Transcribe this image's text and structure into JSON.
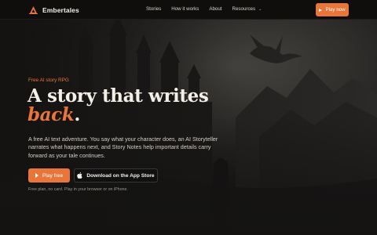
{
  "brand": {
    "name": "Embertales",
    "logo_icon": "flame-icon",
    "accent": "#e8753a"
  },
  "nav": {
    "links": [
      {
        "label": "Stories"
      },
      {
        "label": "How it works"
      },
      {
        "label": "About"
      },
      {
        "label": "Resources",
        "has_menu": true,
        "menu_icon": "chevron-down-icon"
      }
    ],
    "cta_label": "Play now"
  },
  "hero": {
    "eyebrow": "Free AI story RPG",
    "headline_main": "A story that writes",
    "headline_accent": "back",
    "headline_end": ".",
    "lede": "A free AI text adventure. You say what your character does, an AI Storyteller narrates what happens next, and Story Notes help important details carry forward as your tale continues.",
    "primary_button": "Play free",
    "store_button": "Download on the App Store",
    "footnote": "Free plan, no card. Play in your browser or on iPhone."
  },
  "colors": {
    "background": "#141312",
    "accent": "#e8753a",
    "text": "#f3efe7"
  }
}
